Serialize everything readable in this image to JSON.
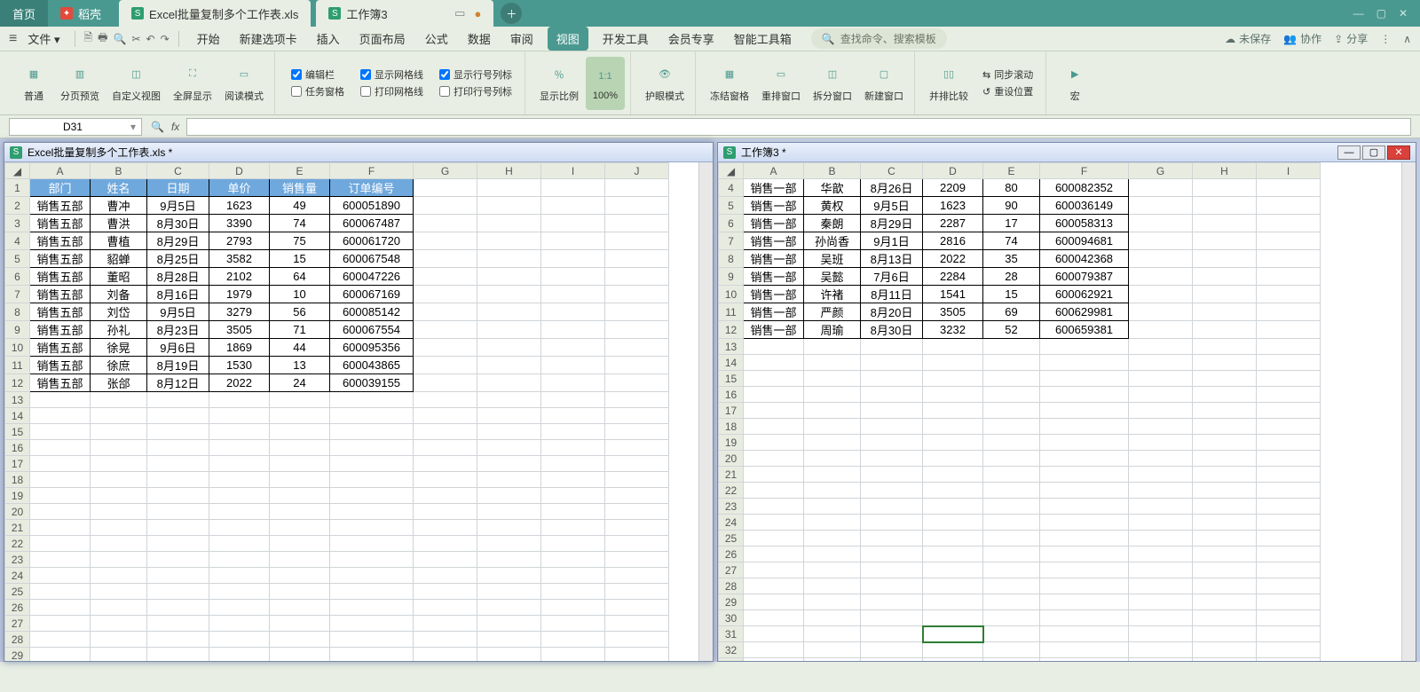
{
  "titlebar": {
    "home": "首页",
    "tab_dake": "稻壳",
    "tab_file": "Excel批量复制多个工作表.xls",
    "tab_active": "工作簿3"
  },
  "menubar": {
    "file": "文件",
    "tabs": [
      "开始",
      "新建选项卡",
      "插入",
      "页面布局",
      "公式",
      "数据",
      "审阅",
      "视图",
      "开发工具",
      "会员专享",
      "智能工具箱"
    ],
    "active_tab_index": 7,
    "search_placeholder": "查找命令、搜索模板",
    "save_status": "未保存",
    "collab": "协作",
    "share": "分享"
  },
  "ribbon": {
    "btns": [
      "普通",
      "分页预览",
      "自定义视图",
      "全屏显示",
      "阅读模式"
    ],
    "checks1": [
      {
        "label": "编辑栏",
        "checked": true
      },
      {
        "label": "任务窗格",
        "checked": false
      }
    ],
    "checks2": [
      {
        "label": "显示网格线",
        "checked": true
      },
      {
        "label": "打印网格线",
        "checked": false
      }
    ],
    "checks3": [
      {
        "label": "显示行号列标",
        "checked": true
      },
      {
        "label": "打印行号列标",
        "checked": false
      }
    ],
    "btns2": [
      "显示比例",
      "100%",
      "护眼模式",
      "冻结窗格",
      "重排窗口",
      "拆分窗口",
      "新建窗口",
      "并排比较"
    ],
    "dis": [
      "同步滚动",
      "重设位置"
    ],
    "macro": "宏"
  },
  "fbar": {
    "cellref": "D31",
    "fx": "fx"
  },
  "left_pane": {
    "title": "Excel批量复制多个工作表.xls *",
    "cols": [
      "A",
      "B",
      "C",
      "D",
      "E",
      "F",
      "G",
      "H",
      "I",
      "J"
    ],
    "headers": [
      "部门",
      "姓名",
      "日期",
      "单价",
      "销售量",
      "订单编号"
    ],
    "rows": [
      [
        "销售五部",
        "曹冲",
        "9月5日",
        "1623",
        "49",
        "600051890"
      ],
      [
        "销售五部",
        "曹洪",
        "8月30日",
        "3390",
        "74",
        "600067487"
      ],
      [
        "销售五部",
        "曹植",
        "8月29日",
        "2793",
        "75",
        "600061720"
      ],
      [
        "销售五部",
        "貂蝉",
        "8月25日",
        "3582",
        "15",
        "600067548"
      ],
      [
        "销售五部",
        "董昭",
        "8月28日",
        "2102",
        "64",
        "600047226"
      ],
      [
        "销售五部",
        "刘备",
        "8月16日",
        "1979",
        "10",
        "600067169"
      ],
      [
        "销售五部",
        "刘岱",
        "9月5日",
        "3279",
        "56",
        "600085142"
      ],
      [
        "销售五部",
        "孙礼",
        "8月23日",
        "3505",
        "71",
        "600067554"
      ],
      [
        "销售五部",
        "徐晃",
        "9月6日",
        "1869",
        "44",
        "600095356"
      ],
      [
        "销售五部",
        "徐庶",
        "8月19日",
        "1530",
        "13",
        "600043865"
      ],
      [
        "销售五部",
        "张郃",
        "8月12日",
        "2022",
        "24",
        "600039155"
      ]
    ],
    "row_start": 1,
    "row_end": 30
  },
  "right_pane": {
    "title": "工作簿3 *",
    "cols": [
      "A",
      "B",
      "C",
      "D",
      "E",
      "F",
      "G",
      "H",
      "I"
    ],
    "row_start": 4,
    "row_end": 33,
    "rows": [
      [
        "销售一部",
        "华歆",
        "8月26日",
        "2209",
        "80",
        "600082352"
      ],
      [
        "销售一部",
        "黄权",
        "9月5日",
        "1623",
        "90",
        "600036149"
      ],
      [
        "销售一部",
        "秦朗",
        "8月29日",
        "2287",
        "17",
        "600058313"
      ],
      [
        "销售一部",
        "孙尚香",
        "9月1日",
        "2816",
        "74",
        "600094681"
      ],
      [
        "销售一部",
        "吴班",
        "8月13日",
        "2022",
        "35",
        "600042368"
      ],
      [
        "销售一部",
        "吴懿",
        "7月6日",
        "2284",
        "28",
        "600079387"
      ],
      [
        "销售一部",
        "许褚",
        "8月11日",
        "1541",
        "15",
        "600062921"
      ],
      [
        "销售一部",
        "严颜",
        "8月20日",
        "3505",
        "69",
        "600629981"
      ],
      [
        "销售一部",
        "周瑜",
        "8月30日",
        "3232",
        "52",
        "600659381"
      ]
    ],
    "selected_row": 31,
    "selected_col": "D"
  }
}
